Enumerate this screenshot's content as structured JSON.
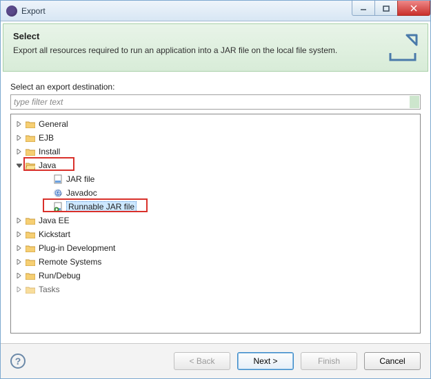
{
  "titlebar": {
    "title": "Export"
  },
  "banner": {
    "heading": "Select",
    "description": "Export all resources required to run an application into a JAR file on the local file system."
  },
  "content": {
    "label": "Select an export destination:",
    "filter_placeholder": "type filter text"
  },
  "tree": {
    "general": "General",
    "ejb": "EJB",
    "install": "Install",
    "java": "Java",
    "jar_file": "JAR file",
    "javadoc": "Javadoc",
    "runnable_jar": "Runnable JAR file",
    "java_ee": "Java EE",
    "kickstart": "Kickstart",
    "plugin_dev": "Plug-in Development",
    "remote_systems": "Remote Systems",
    "run_debug": "Run/Debug",
    "tasks": "Tasks"
  },
  "buttons": {
    "back": "< Back",
    "next": "Next >",
    "finish": "Finish",
    "cancel": "Cancel"
  }
}
